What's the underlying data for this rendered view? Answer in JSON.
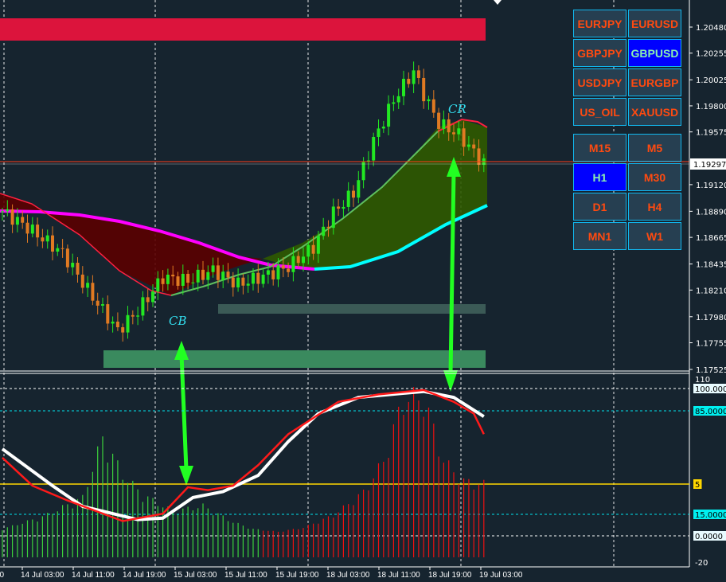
{
  "symbol_buttons": [
    {
      "label": "EURJPY",
      "active": false
    },
    {
      "label": "EURUSD",
      "active": false
    },
    {
      "label": "GBPJPY",
      "active": false
    },
    {
      "label": "GBPUSD",
      "active": true
    },
    {
      "label": "USDJPY",
      "active": false
    },
    {
      "label": "EURGBP",
      "active": false
    },
    {
      "label": "US_OIL",
      "active": false
    },
    {
      "label": "XAUUSD",
      "active": false
    }
  ],
  "timeframe_buttons": [
    {
      "label": "M15",
      "active": false
    },
    {
      "label": "M5",
      "active": false
    },
    {
      "label": "H1",
      "active": true
    },
    {
      "label": "M30",
      "active": false
    },
    {
      "label": "D1",
      "active": false
    },
    {
      "label": "H4",
      "active": false
    },
    {
      "label": "MN1",
      "active": false
    },
    {
      "label": "W1",
      "active": false
    }
  ],
  "signals": {
    "buy": "CB",
    "sell": "CR"
  },
  "current_price_label": "1.19297",
  "chart_data": [
    {
      "type": "candlestick",
      "title": "GBPUSD H1",
      "ylim": [
        1.17525,
        1.2048
      ],
      "y_ticks": [
        "1.20480",
        "1.20255",
        "1.20025",
        "1.19800",
        "1.19575",
        "1.19120",
        "1.18890",
        "1.18665",
        "1.18435",
        "1.18210",
        "1.17980",
        "1.17755",
        "1.17525"
      ],
      "y_tick_values": [
        1.2048,
        1.20255,
        1.20025,
        1.198,
        1.19575,
        1.1912,
        1.1889,
        1.18665,
        1.18435,
        1.1821,
        1.1798,
        1.17755,
        1.17525
      ],
      "x_ticks": [
        "00",
        "14 Jul 03:00",
        "14 Jul 11:00",
        "14 Jul 19:00",
        "15 Jul 03:00",
        "15 Jul 11:00",
        "15 Jul 19:00",
        "18 Jul 03:00",
        "18 Jul 11:00",
        "18 Jul 19:00",
        "19 Jul 03:00"
      ],
      "candle_count": 97,
      "close_keypoints": [
        [
          0,
          1.1889
        ],
        [
          5,
          1.1875
        ],
        [
          12,
          1.1853
        ],
        [
          18,
          1.1815
        ],
        [
          23,
          1.1786
        ],
        [
          27,
          1.1803
        ],
        [
          32,
          1.1832
        ],
        [
          37,
          1.1829
        ],
        [
          42,
          1.1838
        ],
        [
          47,
          1.1826
        ],
        [
          52,
          1.1833
        ],
        [
          57,
          1.1841
        ],
        [
          62,
          1.1858
        ],
        [
          66,
          1.1888
        ],
        [
          70,
          1.1905
        ],
        [
          74,
          1.195
        ],
        [
          78,
          1.1985
        ],
        [
          82,
          1.201
        ],
        [
          84,
          1.199
        ],
        [
          87,
          1.1965
        ],
        [
          91,
          1.1955
        ],
        [
          96,
          1.193
        ]
      ],
      "current_price": 1.19297
    },
    {
      "type": "line",
      "title": "Oscillator",
      "ylim": [
        -20,
        110
      ],
      "y_ticks": [
        "110",
        "100.0000",
        "85.0000",
        "5",
        "15.0000",
        "0.0000",
        "-20"
      ],
      "levels": [
        100,
        85,
        35,
        15,
        0
      ],
      "series": [
        {
          "name": "white",
          "color": "#ffffff",
          "keypoints": [
            [
              0,
              59
            ],
            [
              10,
              34
            ],
            [
              16,
              20
            ],
            [
              27,
              11
            ],
            [
              32,
              12
            ],
            [
              38,
              26
            ],
            [
              44,
              30
            ],
            [
              51,
              41
            ],
            [
              57,
              64
            ],
            [
              63,
              83
            ],
            [
              71,
              94
            ],
            [
              84,
              98
            ],
            [
              90,
              94
            ],
            [
              96,
              81
            ]
          ]
        },
        {
          "name": "red",
          "color": "#ff1a1a",
          "keypoints": [
            [
              0,
              53
            ],
            [
              6,
              34
            ],
            [
              13,
              24
            ],
            [
              24,
              10
            ],
            [
              32,
              15
            ],
            [
              37,
              33
            ],
            [
              41,
              31
            ],
            [
              46,
              34
            ],
            [
              51,
              48
            ],
            [
              57,
              69
            ],
            [
              67,
              91
            ],
            [
              75,
              96
            ],
            [
              84,
              99
            ],
            [
              90,
              91
            ],
            [
              94,
              83
            ],
            [
              96,
              69
            ]
          ]
        }
      ],
      "histogram_keypoints": [
        [
          0,
          5
        ],
        [
          8,
          14
        ],
        [
          16,
          28
        ],
        [
          20,
          72
        ],
        [
          24,
          45
        ],
        [
          28,
          30
        ],
        [
          34,
          18
        ],
        [
          40,
          22
        ],
        [
          46,
          10
        ],
        [
          50,
          5
        ],
        [
          55,
          3
        ],
        [
          60,
          6
        ],
        [
          66,
          15
        ],
        [
          72,
          32
        ],
        [
          76,
          55
        ],
        [
          80,
          101
        ],
        [
          84,
          101
        ],
        [
          88,
          55
        ],
        [
          92,
          40
        ],
        [
          96,
          38
        ]
      ]
    }
  ]
}
